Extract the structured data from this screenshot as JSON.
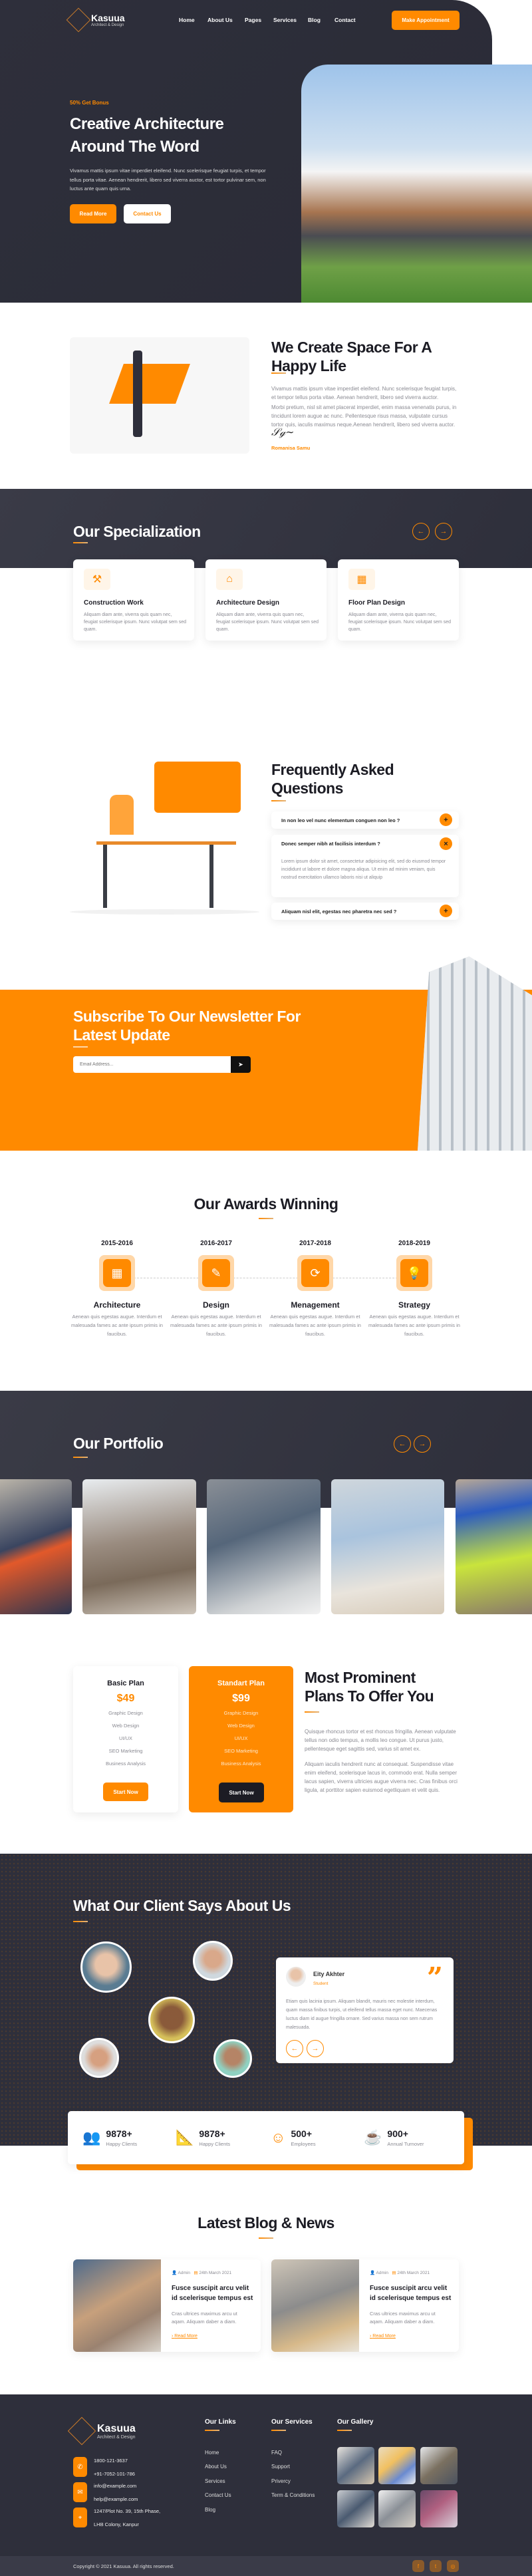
{
  "brand": {
    "name": "Kasuua",
    "tagline": "Architect & Design"
  },
  "nav": {
    "items": [
      "Home",
      "About Us",
      "Pages",
      "Services",
      "Blog",
      "Contact"
    ],
    "cta": "Make Appointment"
  },
  "hero": {
    "kicker": "50% Get Bonus",
    "title_line1": "Creative Architecture",
    "title_line2": "Around The Word",
    "text": "Vivamus mattis ipsum vitae imperdiet eleifend. Nunc scelerisque feugiat turpis, et tempor tellus porta vitae. Aenean hendrerit, libero sed viverra auctor, est tortor pulvinar sem, non luctus ante quam quis urna.",
    "read_more": "Read More",
    "contact": "Contact Us"
  },
  "about": {
    "title": "We Create Space For A Happy Life",
    "p1": "Vivamus mattis ipsum vitae imperdiet eleifend. Nunc scelerisque feugiat turpis, et tempor tellus porta vitae. Aenean hendrerit, libero sed viverra auctor.",
    "p2": "Morbi pretium, nisl sit amet placerat imperdiet, enim massa venenatis purus, in tincidunt lorem augue ac nunc. Pellentesque risus massa, vulputate cursus tortor quis, iaculis maximus neque.Aenean hendrerit, libero sed viverra auctor.",
    "author": "Romanisa Samu"
  },
  "specialization": {
    "title": "Our Specialization",
    "cards": [
      {
        "title": "Construction Work",
        "text": "Aliquam diam ante, viverra quis quam nec, feugiat scelerisque ipsum. Nunc volutpat sem sed quam.",
        "icon": "construction-icon"
      },
      {
        "title": "Architecture Design",
        "text": "Aliquam diam ante, viverra quis quam nec, feugiat scelerisque ipsum. Nunc volutpat sem sed quam.",
        "icon": "house-design-icon"
      },
      {
        "title": "Floor Plan Design",
        "text": "Aliquam diam ante, viverra quis quam nec, feugiat scelerisque ipsum. Nunc volutpat sem sed quam.",
        "icon": "floor-plan-icon"
      }
    ]
  },
  "faq": {
    "title_line1": "Frequently Asked",
    "title_line2": "Questions",
    "items": [
      {
        "q": "In non leo vel nunc elementum conguen non leo ?",
        "open": false
      },
      {
        "q": "Donec semper nibh at facilisis interdum ?",
        "open": true,
        "a": "Lorem ipsum dolor sit amet, consectetur adipisicing elit, sed do eiusmod tempor incididunt ut labore et dolore magna aliqua. Ut enim ad minim veniam, quis nostrud exercitation ullamco laboris nisi ut aliquip"
      },
      {
        "q": "Aliquam nisl elit, egestas nec pharetra nec sed ?",
        "open": false
      }
    ]
  },
  "newsletter": {
    "title_line1": "Subscribe To Our Newsletter For",
    "title_line2": "Latest Update",
    "placeholder": "Email Address..."
  },
  "awards": {
    "title": "Our Awards Winning",
    "items": [
      {
        "years": "2015-2016",
        "name": "Architecture",
        "text": "Aenean quis egestas augue. Interdum et malesuada fames ac ante ipsum primis in faucibus."
      },
      {
        "years": "2016-2017",
        "name": "Design",
        "text": "Aenean quis egestas augue. Interdum et malesuada fames ac ante ipsum primis in faucibus."
      },
      {
        "years": "2017-2018",
        "name": "Menagement",
        "text": "Aenean quis egestas augue. Interdum et malesuada fames ac ante ipsum primis in faucibus."
      },
      {
        "years": "2018-2019",
        "name": "Strategy",
        "text": "Aenean quis egestas augue. Interdum et malesuada fames ac ante ipsum primis in faucibus."
      }
    ]
  },
  "portfolio": {
    "title": "Our Portfolio"
  },
  "pricing": {
    "plans": [
      {
        "name": "Basic Plan",
        "price": "$49",
        "features": [
          "Graphic Design",
          "Web Design",
          "UI/UX",
          "SEO Marketing",
          "Business Analysis"
        ],
        "button": "Start Now"
      },
      {
        "name": "Standart Plan",
        "price": "$99",
        "features": [
          "Graphic Design",
          "Web Design",
          "UI/UX",
          "SEO Marketing",
          "Business Analysis"
        ],
        "button": "Start Now"
      }
    ],
    "title_line1": "Most Prominent",
    "title_line2": "Plans To Offer You",
    "p1": "Quisque rhoncus tortor et est rhoncus fringilla. Aenean vulputate tellus non odio tempus, a mollis leo congue. Ut purus justo, pellentesque eget sagittis sed, varius sit amet ex.",
    "p2": "Aliquam iaculis hendrerit nunc at consequat. Suspendisse vitae enim eleifend, scelerisque lacus in, commodo erat. Nulla semper lacus sapien, viverra ultricies augue viverra nec. Cras finibus orci ligula, at porttitor sapien euismod egetliquam et velit quis."
  },
  "testimonial": {
    "title": "What Our Client Says About Us",
    "name": "Eity Akhter",
    "role": "Student",
    "text": "Etiam quis lacinia ipsum. Aliquam blandit, mauris nec molestie interdum, quam massa finibus turpis, ut eleifend tellus massa eget nunc. Maecenas luctus diam id augue fringilla ornare. Sed varius massa non sem rutrum malesuada."
  },
  "stats": [
    {
      "value": "9878+",
      "label": "Happy Clients",
      "icon": "people-icon"
    },
    {
      "value": "9878+",
      "label": "Happy Clients",
      "icon": "set-square-icon"
    },
    {
      "value": "500+",
      "label": "Employees",
      "icon": "smiley-icon"
    },
    {
      "value": "900+",
      "label": "Annual Turnover",
      "icon": "coffee-icon"
    }
  ],
  "blog": {
    "title": "Latest Blog & News",
    "posts": [
      {
        "author": "Admin",
        "date": "24th March 2021",
        "title": "Fusce suscipit arcu velit id scelerisque tempus est",
        "text": "Cras ultrices maximus arcu ut aqam. Aliquam daber a diam.",
        "link": "Read More"
      },
      {
        "author": "Admin",
        "date": "24th March 2021",
        "title": "Fusce suscipit arcu velit id scelerisque tempus est",
        "text": "Cras ultrices maximus arcu ut aqam. Aliquam daber a diam.",
        "link": "Read More"
      }
    ]
  },
  "footer": {
    "phones": [
      "1800-121-3637",
      "+91-7052-101-786"
    ],
    "emails": [
      "info@example.com",
      "help@example.com"
    ],
    "address": [
      "1247/Plot No. 39, 15th Phase,",
      "LHB Colony, Kanpur"
    ],
    "links_title": "Our Links",
    "links": [
      "Home",
      "About Us",
      "Services",
      "Contact Us",
      "Blog"
    ],
    "services_title": "Our Services",
    "services": [
      "FAQ",
      "Support",
      "Privercy",
      "Term & Conditions"
    ],
    "gallery_title": "Our Gallery",
    "copyright": "Copyright © 2021 Kasuua. All rights reserved.",
    "social": [
      "facebook-icon",
      "twitter-icon",
      "instagram-icon"
    ]
  },
  "colors": {
    "accent": "#ff8a00",
    "dark": "#2e2f3b"
  }
}
